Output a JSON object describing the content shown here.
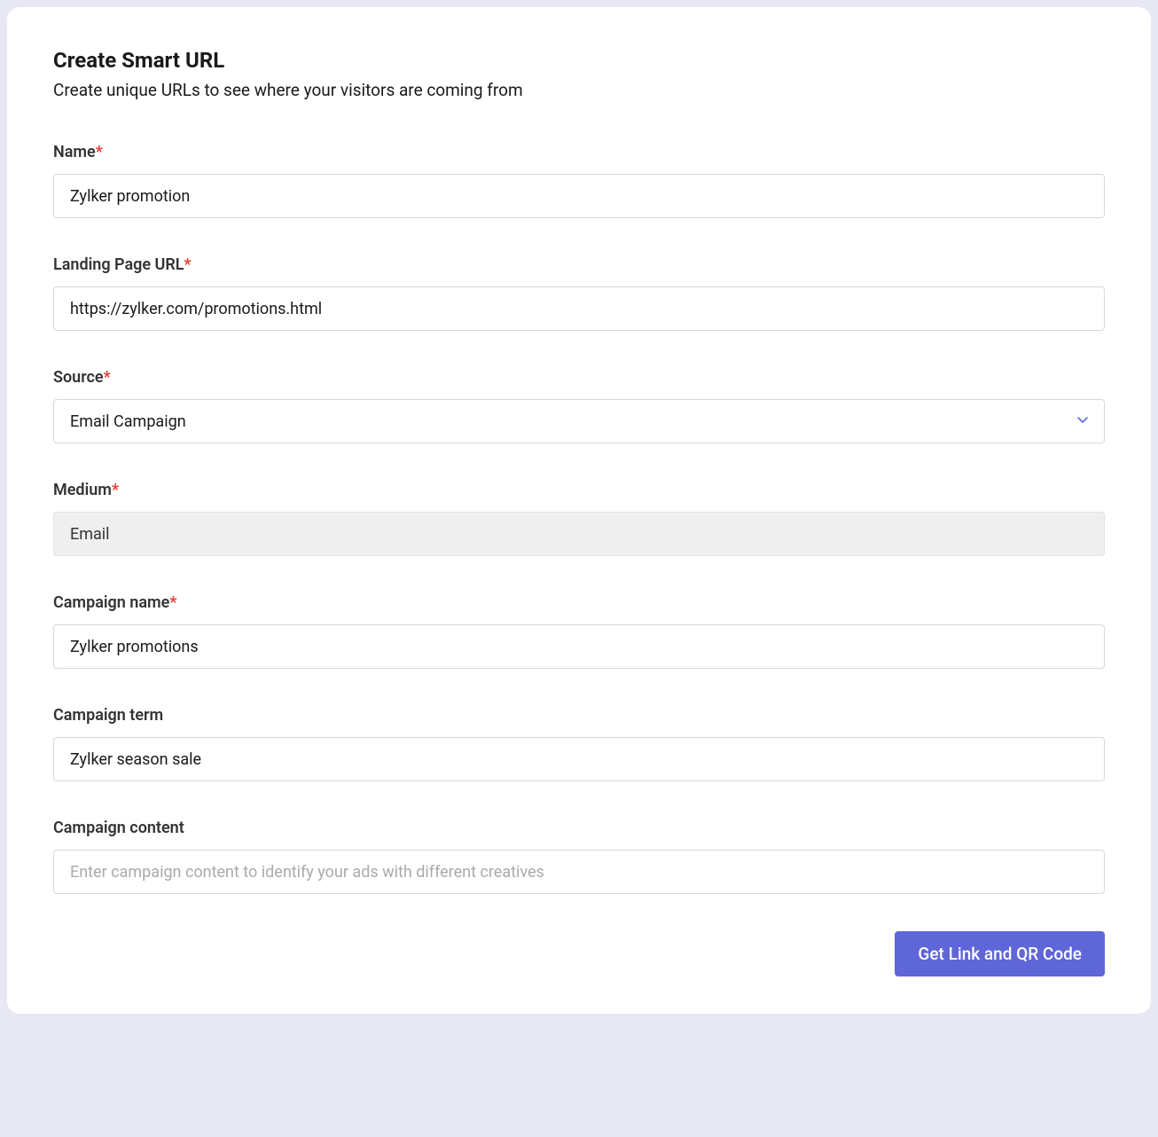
{
  "header": {
    "title": "Create Smart URL",
    "subtitle": "Create unique URLs to see where your visitors are coming from"
  },
  "fields": {
    "name": {
      "label": "Name",
      "required": true,
      "value": "Zylker promotion",
      "placeholder": ""
    },
    "landing_page_url": {
      "label": "Landing Page URL",
      "required": true,
      "value": "https://zylker.com/promotions.html",
      "placeholder": ""
    },
    "source": {
      "label": "Source",
      "required": true,
      "value": "Email Campaign"
    },
    "medium": {
      "label": "Medium",
      "required": true,
      "value": "Email",
      "readonly": true
    },
    "campaign_name": {
      "label": "Campaign name",
      "required": true,
      "value": "Zylker promotions",
      "placeholder": ""
    },
    "campaign_term": {
      "label": "Campaign term",
      "required": false,
      "value": "Zylker season sale",
      "placeholder": ""
    },
    "campaign_content": {
      "label": "Campaign content",
      "required": false,
      "value": "",
      "placeholder": "Enter campaign content to identify your ads with different creatives"
    }
  },
  "actions": {
    "submit_label": "Get Link and QR Code"
  }
}
